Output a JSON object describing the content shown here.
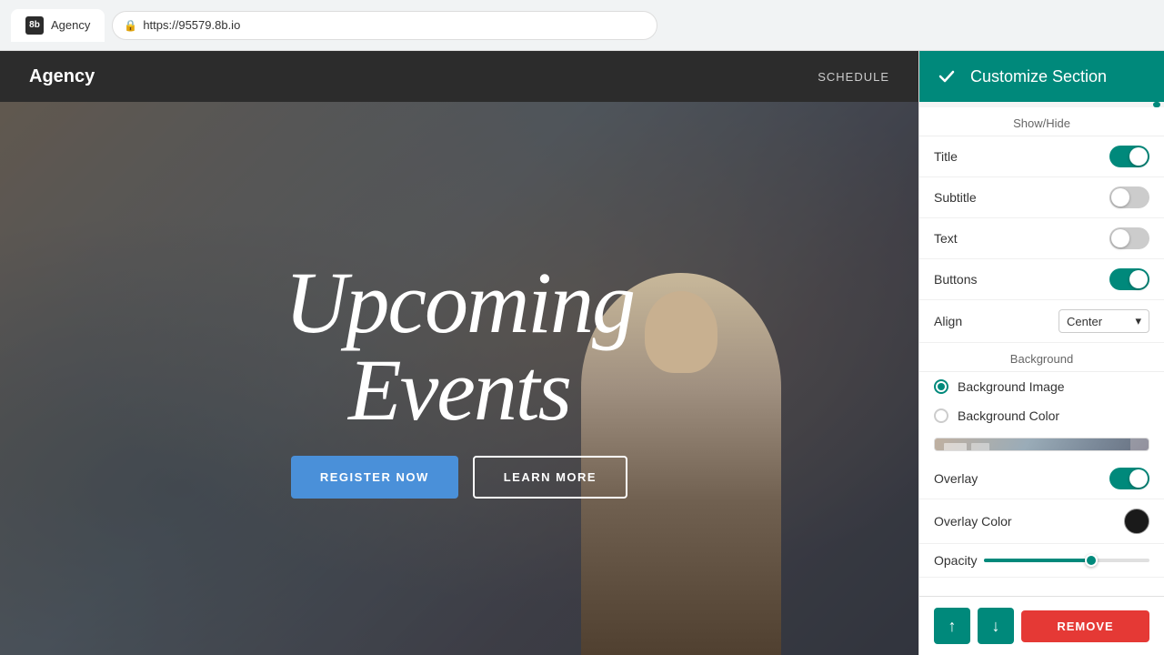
{
  "browser": {
    "tab_logo": "8b",
    "tab_title": "Agency",
    "url": "https://95579.8b.io",
    "lock_icon": "🔒"
  },
  "site": {
    "nav_logo": "Agency",
    "nav_links": [
      "SCHEDULE"
    ],
    "hero": {
      "title_line1": "Upcoming",
      "title_line2": "Events",
      "btn_primary": "REGISTER NOW",
      "btn_secondary": "LEARN MORE"
    }
  },
  "panel": {
    "header_title": "Customize Section",
    "check_icon": "✓",
    "section_show_hide": "Show/Hide",
    "section_background": "Background",
    "toggles": [
      {
        "label": "Title",
        "state": "on"
      },
      {
        "label": "Subtitle",
        "state": "off"
      },
      {
        "label": "Text",
        "state": "off"
      },
      {
        "label": "Buttons",
        "state": "on"
      }
    ],
    "align_label": "Align",
    "align_value": "Center",
    "align_chevron": "▾",
    "bg_options": [
      {
        "label": "Background Image",
        "selected": true
      },
      {
        "label": "Background Color",
        "selected": false
      }
    ],
    "overlay_label": "Overlay",
    "overlay_state": "on",
    "overlay_color_label": "Overlay Color",
    "overlay_color": "#1a1a1a",
    "opacity_label": "Opacity",
    "opacity_value": 65,
    "btn_up_label": "↑",
    "btn_down_label": "↓",
    "btn_remove_label": "REMOVE"
  }
}
